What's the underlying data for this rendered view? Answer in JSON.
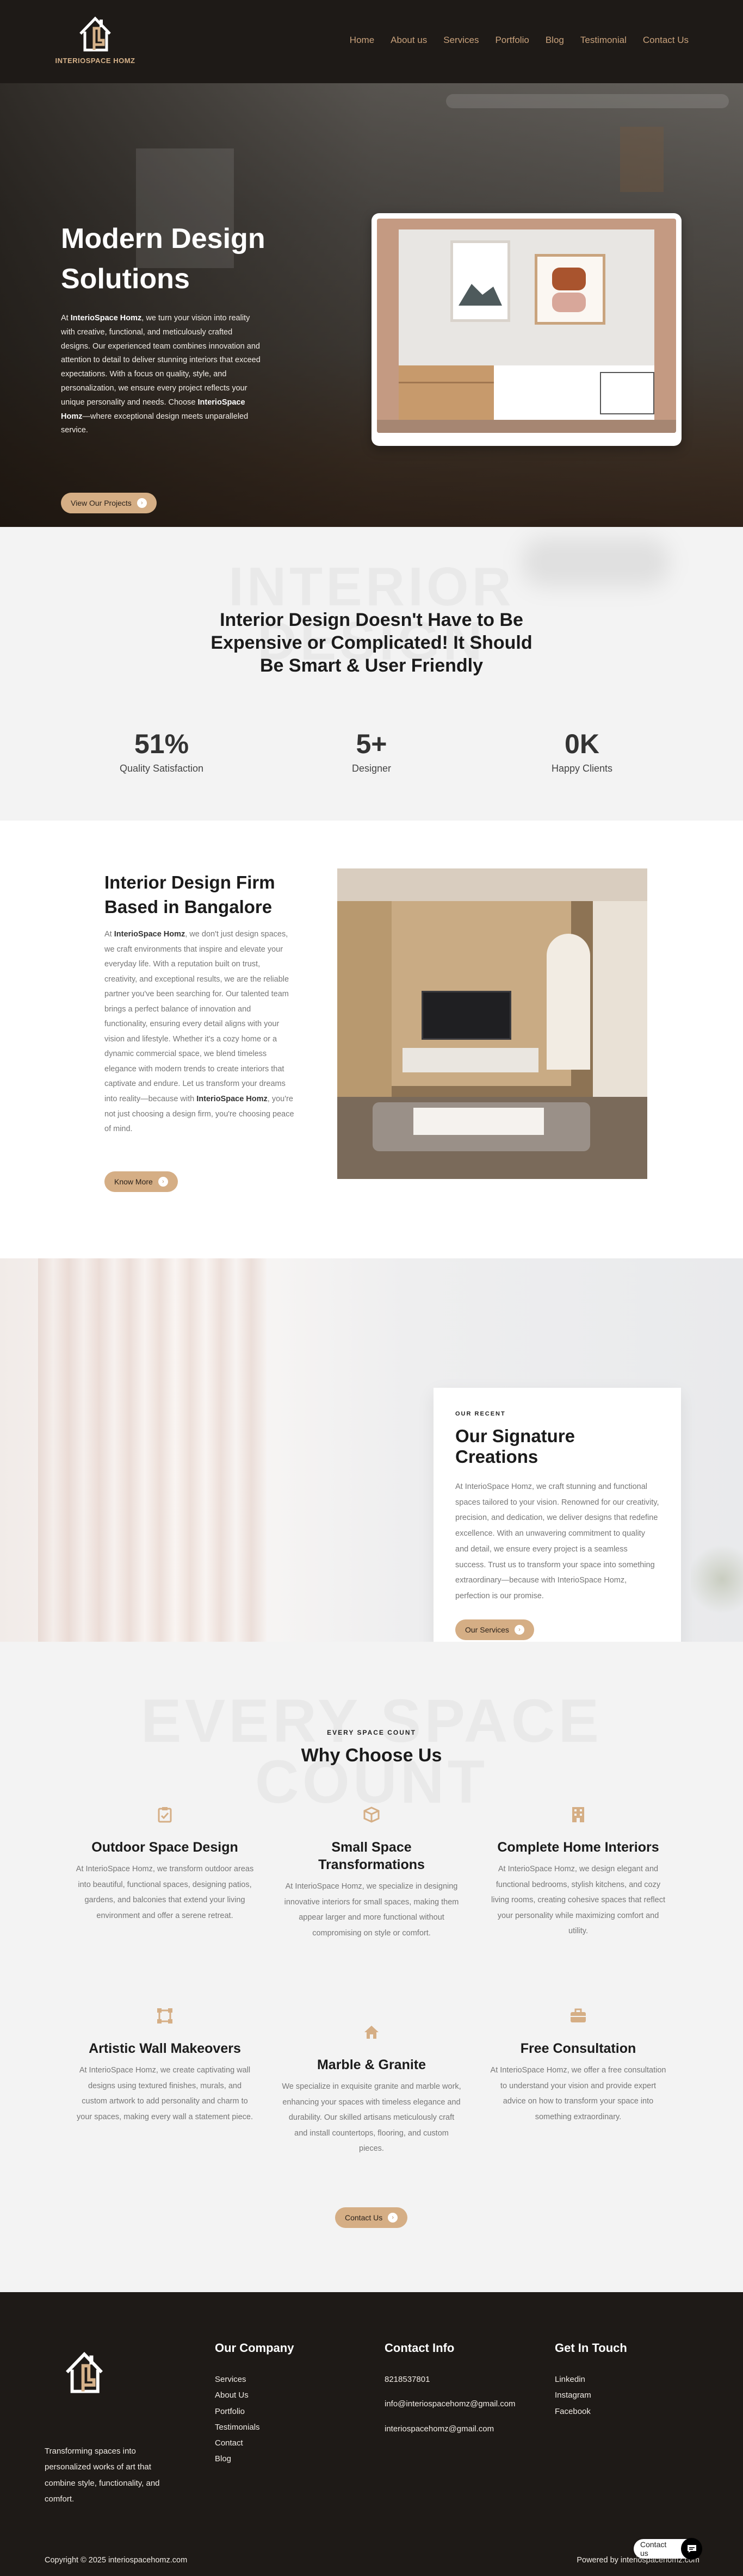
{
  "brand": {
    "name": "INTERIOSPACE HOMZ",
    "accent": "#d5ae85",
    "dark": "#1e1a17"
  },
  "nav": {
    "items": [
      "Home",
      "About us",
      "Services",
      "Portfolio",
      "Blog",
      "Testimonial",
      "Contact Us"
    ]
  },
  "hero": {
    "title": "Modern Design Solutions",
    "text_prefix": "At ",
    "text_brand": "InterioSpace Homz",
    "text_body": ", we turn your vision into reality with creative, functional, and meticulously crafted designs. Our experienced team combines innovation and attention to detail to deliver stunning interiors that exceed expectations. With a focus on quality, style, and personalization, we ensure every project reflects your unique personality and needs. Choose ",
    "text_brand2": "InterioSpace Homz",
    "text_end": "—where exceptional design meets unparalleled service.",
    "button": "View Our Projects"
  },
  "stats": {
    "ghost": "INTERIOR DESIGN",
    "title": "Interior Design Doesn't Have to Be Expensive or Complicated! It Should Be Smart & User Friendly",
    "items": [
      {
        "value": "51%",
        "label": "Quality Satisfaction"
      },
      {
        "value": "5+",
        "label": "Designer"
      },
      {
        "value": "0K",
        "label": "Happy Clients"
      }
    ]
  },
  "about": {
    "title": "Interior Design Firm Based in Bangalore",
    "text_prefix": "At ",
    "text_brand": "InterioSpace Homz",
    "text_body": ", we don't just design spaces, we craft environments that inspire and elevate your everyday life. With a reputation built on trust, creativity, and exceptional results, we are the reliable partner you've been searching for. Our talented team brings a perfect balance of innovation and functionality, ensuring every detail aligns with your vision and lifestyle. Whether it's a cozy home or a dynamic commercial space, we blend timeless elegance with modern trends to create interiors that captivate and endure. Let us transform your dreams into reality—because with ",
    "text_brand2": "InterioSpace Homz",
    "text_end": ", you're not just choosing a design firm, you're choosing peace of mind.",
    "button": "Know More"
  },
  "signature": {
    "kicker": "OUR RECENT",
    "title": "Our Signature Creations",
    "text": "At InterioSpace Homz, we craft stunning and functional spaces tailored to your vision. Renowned for our creativity, precision, and dedication, we deliver designs that redefine excellence. With an unwavering commitment to quality and detail, we ensure every project is a seamless success. Trust us to transform your space into something extraordinary—because with InterioSpace Homz, perfection is our promise.",
    "button": "Our Services"
  },
  "why": {
    "ghost": "EVERY SPACE COUNT",
    "kicker": "EVERY SPACE COUNT",
    "title": "Why Choose Us",
    "services": [
      {
        "icon": "clipboard-check-icon",
        "title": "Outdoor Space Design",
        "text": "At InterioSpace Homz, we transform outdoor areas into beautiful, functional spaces, designing patios, gardens, and balconies that extend your living environment and offer a serene retreat."
      },
      {
        "icon": "cube-icon",
        "title": "Small Space Transformations",
        "text": "At InterioSpace Homz, we specialize in designing innovative interiors for small spaces, making them appear larger and more functional without compromising on style or comfort."
      },
      {
        "icon": "building-icon",
        "title": "Complete Home Interiors",
        "text": "At InterioSpace Homz, we design elegant and functional bedrooms, stylish kitchens, and cozy living rooms, creating cohesive spaces that reflect your personality while maximizing comfort and utility."
      },
      {
        "icon": "vector-square-icon",
        "title": "Artistic Wall Makeovers",
        "text": "At InterioSpace Homz, we create captivating wall designs using textured finishes, murals, and custom artwork to add personality and charm to your spaces, making every wall a statement piece."
      },
      {
        "icon": "home-icon",
        "title": "Marble & Granite",
        "text": "We specialize in exquisite granite and marble work, enhancing your spaces with timeless elegance and durability. Our skilled artisans meticulously craft and install countertops, flooring, and custom pieces."
      },
      {
        "icon": "briefcase-icon",
        "title": "Free Consultation",
        "text": "At InterioSpace Homz, we offer a free consultation to understand your vision and provide expert advice on how to transform your space into something extraordinary."
      }
    ],
    "button": "Contact Us"
  },
  "footer": {
    "tagline": "Transforming spaces into personalized works of art that combine style, functionality, and comfort.",
    "company": {
      "heading": "Our Company",
      "links": [
        "Services",
        "About Us",
        "Portfolio",
        "Testimonials",
        "Contact",
        "Blog"
      ]
    },
    "contact": {
      "heading": "Contact Info",
      "phone": "8218537801",
      "email1": "info@interiospacehomz@gmail.com",
      "email2": "interiospacehomz@gmail.com"
    },
    "social": {
      "heading": "Get In Touch",
      "links": [
        "Linkedin",
        "Instagram",
        "Facebook"
      ]
    },
    "copyright": "Copyright © 2025 interiospacehomz.com",
    "powered": "Powered by interiospacehomz.com",
    "chat_label": "Contact us"
  }
}
